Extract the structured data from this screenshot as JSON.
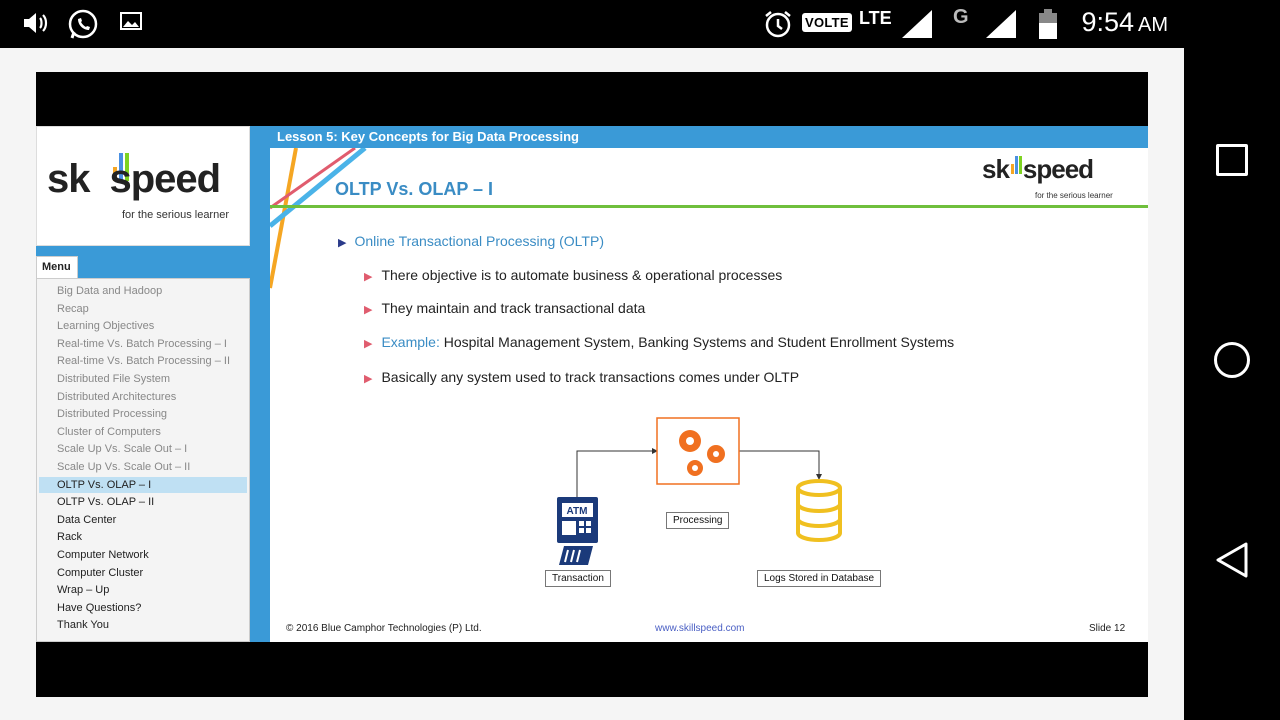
{
  "status_bar": {
    "icons": [
      "volume-icon",
      "whatsapp-icon",
      "image-icon",
      "alarm-icon",
      "signal-icon",
      "battery-icon"
    ],
    "volte": "VOLTE",
    "lte": "LTE",
    "network_g": "G",
    "time": "9:54",
    "ampm": "AM"
  },
  "player": {
    "lesson_title": "Lesson 5: Key Concepts for Big Data Processing",
    "logo": {
      "prefix": "sk",
      "suffix": "speed",
      "tagline": "for the serious learner"
    },
    "menu_label": "Menu",
    "menu_items": [
      {
        "label": "Big Data and Hadoop",
        "state": "visited"
      },
      {
        "label": "Recap",
        "state": "visited"
      },
      {
        "label": "Learning Objectives",
        "state": "visited"
      },
      {
        "label": "Real-time Vs. Batch Processing – I",
        "state": "visited"
      },
      {
        "label": "Real-time Vs. Batch Processing – II",
        "state": "visited"
      },
      {
        "label": "Distributed File System",
        "state": "visited"
      },
      {
        "label": "Distributed Architectures",
        "state": "visited"
      },
      {
        "label": "Distributed Processing",
        "state": "visited"
      },
      {
        "label": "Cluster of Computers",
        "state": "visited"
      },
      {
        "label": "Scale Up Vs. Scale Out – I",
        "state": "visited"
      },
      {
        "label": "Scale Up Vs. Scale Out – II",
        "state": "visited"
      },
      {
        "label": "OLTP Vs. OLAP – I",
        "state": "active"
      },
      {
        "label": "OLTP Vs. OLAP – II",
        "state": "unvisited"
      },
      {
        "label": "Data Center",
        "state": "unvisited"
      },
      {
        "label": "Rack",
        "state": "unvisited"
      },
      {
        "label": "Computer Network",
        "state": "unvisited"
      },
      {
        "label": "Computer Cluster",
        "state": "unvisited"
      },
      {
        "label": "Wrap – Up",
        "state": "unvisited"
      },
      {
        "label": "Have Questions?",
        "state": "unvisited"
      },
      {
        "label": "Thank You",
        "state": "unvisited"
      }
    ]
  },
  "slide": {
    "title": "OLTP Vs. OLAP – I",
    "logo_tagline": "for the serious learner",
    "main_bullet": "Online Transactional Processing (OLTP)",
    "sub_bullets": [
      {
        "prefix": "",
        "text": "There objective is to automate business & operational processes"
      },
      {
        "prefix": "",
        "text": "They maintain and track transactional data"
      },
      {
        "prefix": "Example:",
        "text": " Hospital Management System, Banking Systems and Student Enrollment Systems"
      },
      {
        "prefix": "",
        "text": "Basically any system used to track transactions comes under OLTP"
      }
    ],
    "diagram": {
      "atm_text": "ATM",
      "transaction_label": "Transaction",
      "processing_label": "Processing",
      "database_label": "Logs Stored in Database"
    },
    "footer": {
      "copyright": "© 2016 Blue Camphor Technologies (P) Ltd.",
      "website": "www.skillspeed.com",
      "slide_number": "Slide 12"
    }
  },
  "colors": {
    "accent_blue": "#3a9ad7",
    "title_blue": "#3a8cc4",
    "green_rule": "#6fbf3c",
    "bullet_red": "#e05c6e",
    "gear_orange": "#f07020",
    "db_yellow": "#f0c020",
    "atm_navy": "#1b3a7a"
  }
}
